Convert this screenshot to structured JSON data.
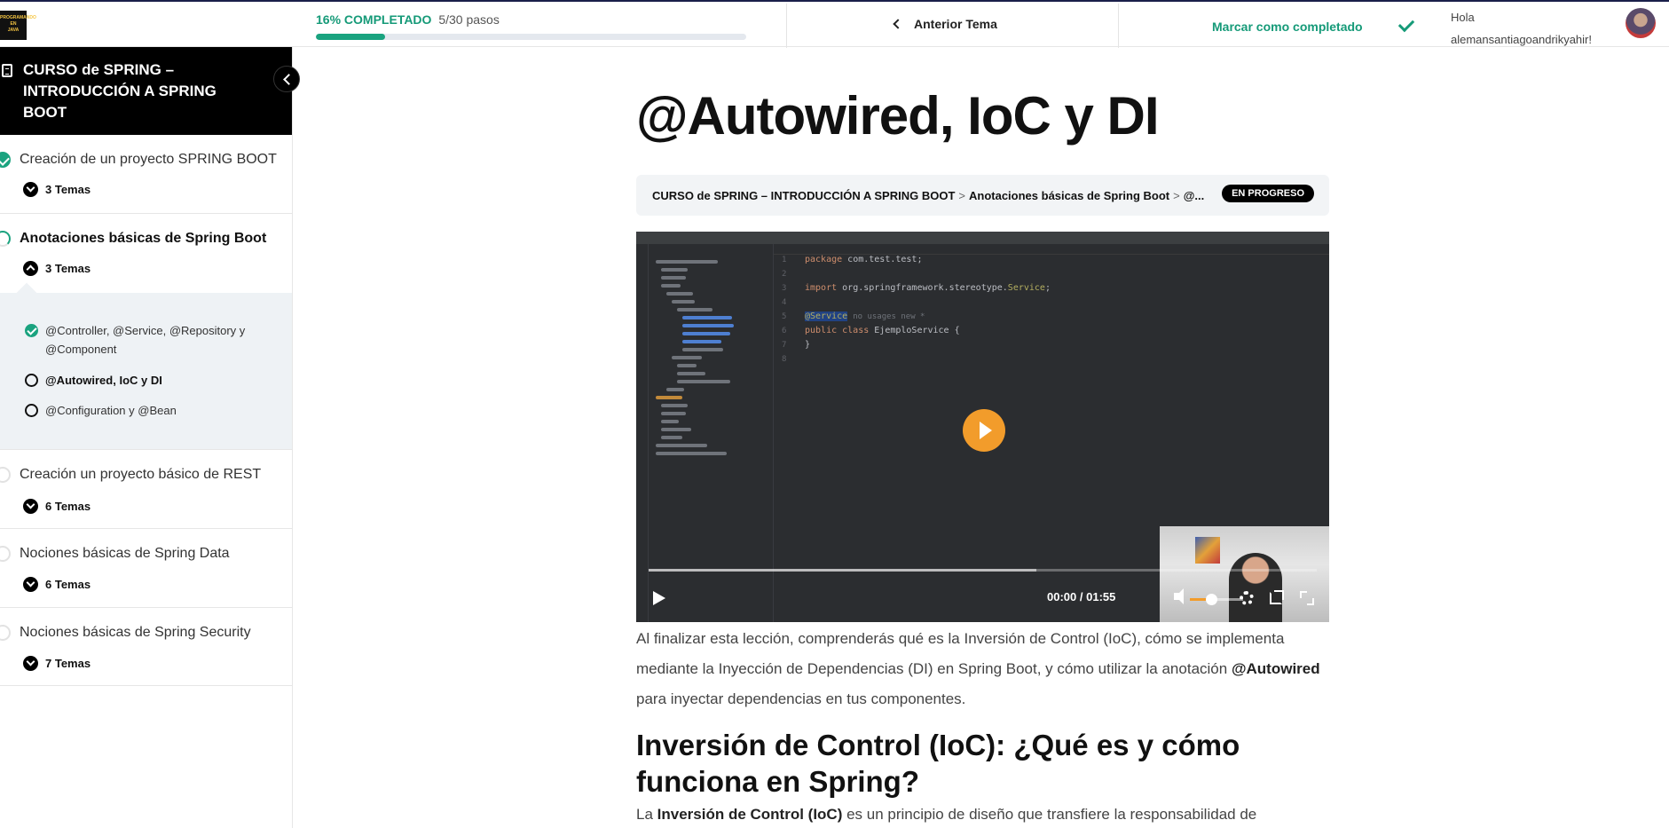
{
  "logo": {
    "line1": "PROGRAMANDO",
    "line2": "EN",
    "line3": "JAVA"
  },
  "header": {
    "progress_percent_label": "16% COMPLETADO",
    "progress_steps": "5/30 pasos",
    "progress_fraction": 0.16,
    "prev_topic_label": "Anterior Tema",
    "mark_complete_label": "Marcar como completado",
    "greeting_line1": "Hola",
    "greeting_line2": "alemansantiagoandrikyahir!"
  },
  "sidebar": {
    "course_title": "CURSO de SPRING – INTRODUCCIÓN A SPRING BOOT",
    "lessons": [
      {
        "title": "Creación de un proyecto SPRING BOOT",
        "topics": "3 Temas",
        "status": "done"
      },
      {
        "title": "Anotaciones básicas de Spring Boot",
        "topics": "3 Temas",
        "status": "partial"
      },
      {
        "title": "Creación un proyecto básico de REST",
        "topics": "6 Temas",
        "status": "none"
      },
      {
        "title": "Nociones básicas de Spring Data",
        "topics": "6 Temas",
        "status": "none"
      },
      {
        "title": "Nociones básicas de Spring Security",
        "topics": "7 Temas",
        "status": "none"
      }
    ],
    "topics": [
      {
        "line1": "@Controller, @Service, @Repository y",
        "line2": "@Component",
        "status": "done"
      },
      {
        "line1": "@Autowired, IoC y DI",
        "line2": "",
        "status": "current"
      },
      {
        "line1": "@Configuration y @Bean",
        "line2": "",
        "status": "none"
      }
    ]
  },
  "main": {
    "title": "@Autowired, IoC y DI",
    "breadcrumb": {
      "course": "CURSO de SPRING – INTRODUCCIÓN A SPRING BOOT",
      "sep": ">",
      "lesson": "Anotaciones básicas de Spring Boot",
      "current": "@...",
      "badge": "EN PROGRESO"
    },
    "video": {
      "time_current": "00:00",
      "time_sep": "/",
      "time_total": "01:55",
      "volume_fraction": 0.4,
      "buffered_fraction": 0.58,
      "code": {
        "line1": "package com.test.test;",
        "line3_kw": "import",
        "line3_rest": "org.springframework.stereotype.",
        "line3_ann": "Service",
        "line5_ann": "@Service",
        "line5_hint": "no usages  new *",
        "line6_kw": "public class",
        "line6_rest": "EjemploService {",
        "line7": "}"
      }
    },
    "intro": {
      "part1": "Al finalizar esta lección, comprenderás qué es la Inversión de Control (IoC), cómo se implementa mediante la Inyección de Dependencias (DI) en Spring Boot, y cómo utilizar la anotación ",
      "bold": "@Autowired",
      "part2": " para inyectar dependencias en tus componentes."
    },
    "h2": "Inversión de Control (IoC): ¿Qué es y cómo funciona en Spring?",
    "p2": {
      "part1": "La ",
      "bold": "Inversión de Control (IoC)",
      "part2": " es un principio de diseño que transfiere la responsabilidad de"
    }
  }
}
